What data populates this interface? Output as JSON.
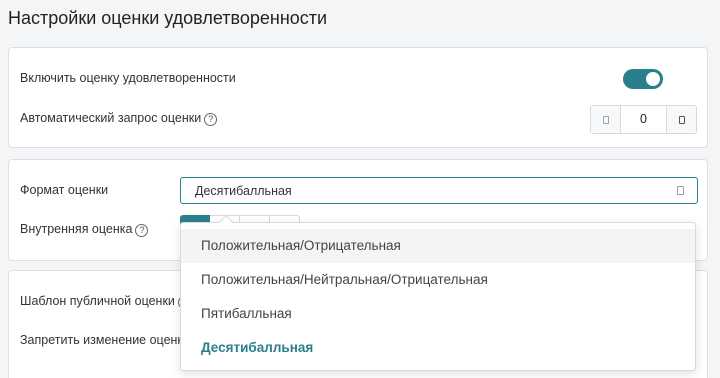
{
  "page": {
    "title": "Настройки оценки удовлетворенности"
  },
  "general": {
    "enable_label": "Включить оценку удовлетворенности",
    "enable_value": true,
    "auto_request_label": "Автоматический запрос оценки",
    "auto_request_value": "0"
  },
  "format": {
    "format_label": "Формат оценки",
    "format_value": "Десятибалльная",
    "internal_label": "Внутренняя оценка"
  },
  "template": {
    "public_template_label": "Шаблон публичной оценки",
    "forbid_change_label": "Запретить изменение оценки"
  },
  "dropdown": {
    "options": [
      "Положительная/Отрицательная",
      "Положительная/Нейтральная/Отрицательная",
      "Пятибалльная",
      "Десятибалльная"
    ],
    "hovered_index": 0,
    "selected_index": 3
  },
  "colors": {
    "accent": "#2a7f8c",
    "border": "#dcdfe3"
  },
  "icons": {
    "help": "question-circle-icon",
    "select_caret": "dropdown-caret-icon"
  }
}
